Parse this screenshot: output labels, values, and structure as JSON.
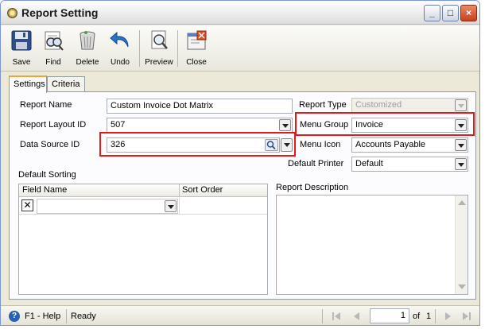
{
  "window": {
    "title": "Report Setting",
    "controls": {
      "minimize": "_",
      "maximize": "□",
      "close": "×"
    }
  },
  "toolbar": {
    "buttons": [
      {
        "label": "Save",
        "icon": "floppy-disk-icon"
      },
      {
        "label": "Find",
        "icon": "binoculars-icon"
      },
      {
        "label": "Delete",
        "icon": "trash-can-icon"
      },
      {
        "label": "Undo",
        "icon": "undo-arrow-icon"
      },
      {
        "label": "Preview",
        "icon": "magnifier-page-icon"
      },
      {
        "label": "Close",
        "icon": "close-window-icon"
      }
    ]
  },
  "tabs": [
    {
      "label": "Settings",
      "active": true
    },
    {
      "label": "Criteria",
      "active": false
    }
  ],
  "form": {
    "report_name_label": "Report Name",
    "report_name_value": "Custom Invoice Dot Matrix",
    "report_layout_id_label": "Report Layout ID",
    "report_layout_id_value": "507",
    "data_source_id_label": "Data Source ID",
    "data_source_id_value": "326",
    "report_type_label": "Report Type",
    "report_type_value": "Customized",
    "menu_group_label": "Menu Group",
    "menu_group_value": "Invoice",
    "menu_icon_label": "Menu Icon",
    "menu_icon_value": "Accounts Payable",
    "default_printer_label": "Default Printer",
    "default_printer_value": "Default",
    "default_sorting_label": "Default Sorting",
    "report_description_label": "Report Description"
  },
  "sorting_grid": {
    "columns": [
      "Field Name",
      "Sort Order"
    ],
    "rows": [
      {
        "delete_glyph": "✕",
        "field_name": "",
        "sort_order": ""
      }
    ]
  },
  "statusbar": {
    "help_glyph": "?",
    "help_label": "F1 - Help",
    "status_text": "Ready",
    "page_current": "1",
    "page_of_label": "of",
    "page_total": "1"
  },
  "colors": {
    "highlight_border": "#e11b1b",
    "window_bg": "#ece9d8",
    "active_tab_accent": "#f2a23a"
  }
}
